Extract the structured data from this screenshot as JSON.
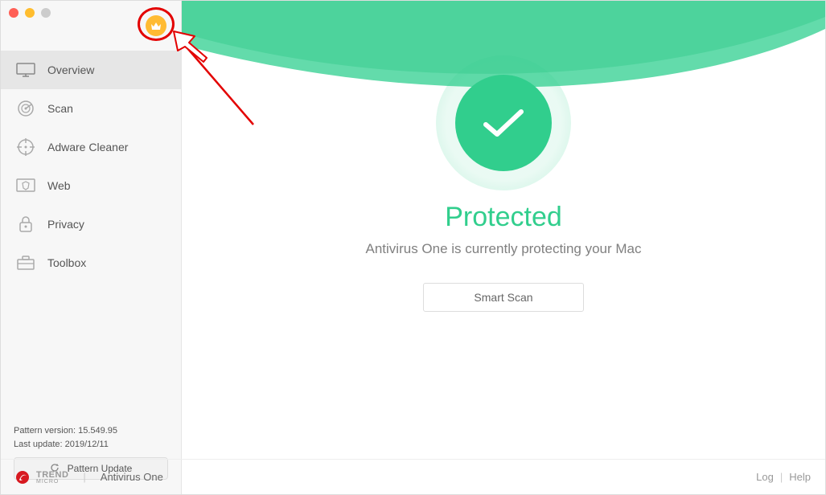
{
  "sidebar": {
    "items": [
      {
        "label": "Overview",
        "icon": "monitor-icon"
      },
      {
        "label": "Scan",
        "icon": "radar-icon"
      },
      {
        "label": "Adware Cleaner",
        "icon": "target-icon"
      },
      {
        "label": "Web",
        "icon": "shield-icon"
      },
      {
        "label": "Privacy",
        "icon": "lock-icon"
      },
      {
        "label": "Toolbox",
        "icon": "toolbox-icon"
      }
    ]
  },
  "status": {
    "title": "Protected",
    "subtitle": "Antivirus One is currently protecting your Mac",
    "scan_button": "Smart Scan"
  },
  "pattern": {
    "version_label": "Pattern version: 15.549.95",
    "last_update_label": "Last update: 2019/12/11",
    "button": "Pattern Update"
  },
  "footer": {
    "brand": "TREND",
    "brand_sub": "MICRO",
    "product": "Antivirus One",
    "log": "Log",
    "help": "Help"
  }
}
